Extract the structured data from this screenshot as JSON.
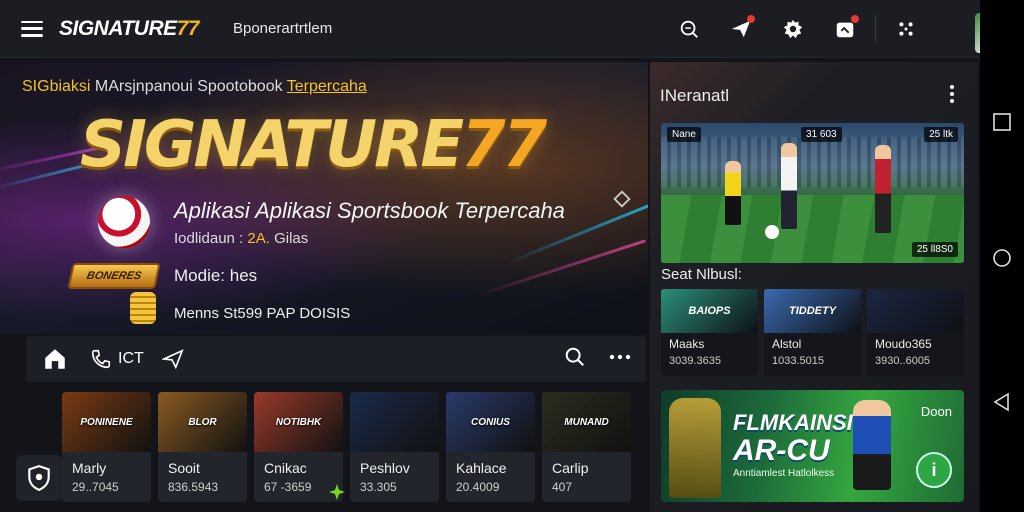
{
  "topbar": {
    "brand_text": "SIGNATURE",
    "brand_num": "77",
    "subtitle": "Bponerartrtlem",
    "icons": [
      "search-icon",
      "send-icon",
      "settings-icon",
      "notification-icon",
      "grid-icon"
    ]
  },
  "hero": {
    "tag_pre": "SIGbiaksi",
    "tag_mid": " MArsjnpanoui Spootobook ",
    "tag_link": "Terpercaha",
    "title": "SIGNATURE",
    "title_num": "77",
    "line1": "Aplikasi Aplikasi Sportsbook Terpercaha",
    "line2_label": "Iodlidaun : ",
    "line2_value": "2A.",
    "line2_rest": " Gilas",
    "pill": "BONERES",
    "line3": "Modie: hes",
    "line4": "Menns St599 PAP DOISIS"
  },
  "herobar": {
    "call_text": "ICT"
  },
  "tiles": [
    {
      "name": "Marly",
      "value": "29..7045",
      "art": "PONINENE",
      "bg": "#7a3a12"
    },
    {
      "name": "Sooit",
      "value": "836.5943",
      "art": "BLOR",
      "bg": "#8a5a22"
    },
    {
      "name": "Cnikac",
      "value": "67 -3659",
      "art": "NOTIBHK",
      "bg": "#9a3a2a"
    },
    {
      "name": "Peshlov",
      "value": "33.305",
      "art": "",
      "bg": "#1a2a4a"
    },
    {
      "name": "Kahlace",
      "value": "20.4009",
      "art": "CONIUS",
      "bg": "#2a3a6a"
    },
    {
      "name": "Carlip",
      "value": "407",
      "art": "MUNAND",
      "bg": "#2a2e1e"
    }
  ],
  "right": {
    "title": "INeranatl",
    "match_chips": [
      "Nane",
      "31 603",
      "25 ltk"
    ],
    "match_score": "25 ll8S0",
    "sub": "Seat Nlbusl:",
    "minis": [
      {
        "name": "Maaks",
        "value": "3039.3635",
        "art": "BAIOPS",
        "bg": "#2a8f7a"
      },
      {
        "name": "Alstol",
        "value": "1033.5015",
        "art": "TIDDETY",
        "bg": "#3a6ab0"
      },
      {
        "name": "Moudo365",
        "value": "3930..6005",
        "art": "",
        "bg": "#1c2640"
      }
    ],
    "promo": {
      "l1": "FLMKAINSI",
      "l2": "AR-CU",
      "l3": "Anntiamlest Hatlolkess",
      "corner": "Doon",
      "info": "i"
    }
  },
  "colors": {
    "accent": "#f2b51e",
    "bg": "#121419",
    "promo_green": "#2fa644"
  }
}
